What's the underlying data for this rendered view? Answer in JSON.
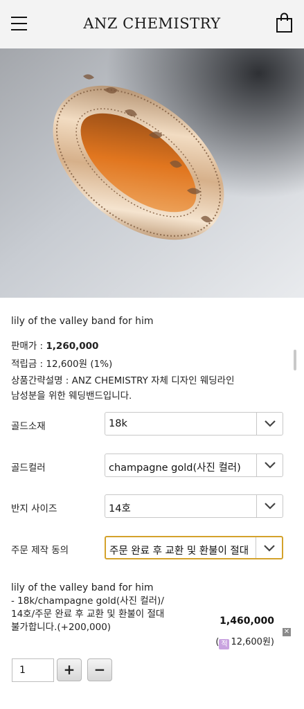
{
  "header": {
    "brand": "ANZ CHEMISTRY",
    "menu_icon": "hamburger-menu-icon",
    "cart_icon": "shopping-bag-icon"
  },
  "product": {
    "name": "lily of the valley band for him",
    "price_label": "판매가 : ",
    "price_value": "1,260,000",
    "points": "적립금 : 12,600원 (1%)",
    "desc_line1": "상품간략설명 : ANZ CHEMISTRY 자체 디자인 웨딩라인",
    "desc_line2": "남성분을 위한 웨딩밴드입니다."
  },
  "options": [
    {
      "label": "골드소재",
      "value": "18k"
    },
    {
      "label": "골드컬러",
      "value": "champagne gold(사진 컬러)"
    },
    {
      "label": "반지 사이즈",
      "value": "14호"
    },
    {
      "label": "주문 제작 동의",
      "value": "주문 완료 후 교환 및 환불이 절대"
    }
  ],
  "selection": {
    "name": "lily of the valley band for him",
    "line1": "- 18k/champagne gold(사진 컬러)/",
    "line2": "14호/주문 완료 후 교환 및 환불이 절대",
    "line3": "불가합니다.(+200,000)",
    "total": "1,460,000",
    "points_badge": "적",
    "points": "12,600원)",
    "points_open": "(",
    "remove": "✕"
  },
  "quantity": {
    "value": "1",
    "plus": "+",
    "minus": "−"
  },
  "colors": {
    "header_bg": "#f3f3f3",
    "focus_border": "#d4a22b",
    "points_badge": "#c9a3e0"
  }
}
